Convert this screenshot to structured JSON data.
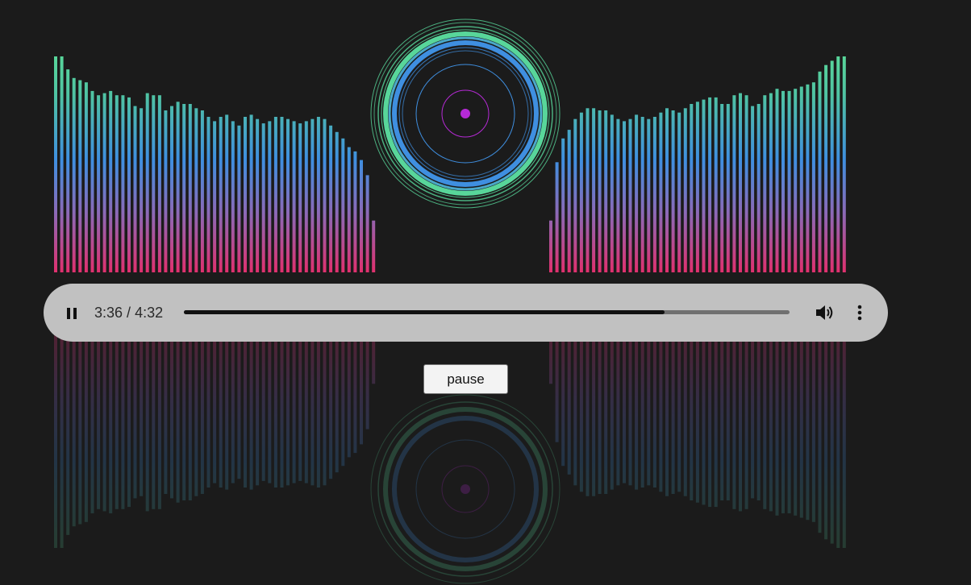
{
  "player": {
    "current_time": "3:36",
    "separator": " / ",
    "duration": "4:32",
    "progress": 0.7941
  },
  "pause_button": {
    "label": "pause"
  },
  "colors": {
    "background": "#1b1b1b",
    "bar_top": "#58d69a",
    "bar_mid": "#3f8fe0",
    "bar_bottom": "#e0306e",
    "disc_center": "#b62ad6",
    "player_bg": "#c1c1c1"
  },
  "icons": {
    "play_state": "pause-icon",
    "volume": "speaker-icon",
    "menu": "more-vertical-icon"
  },
  "spectrum": {
    "left_levels": [
      1.0,
      1.0,
      0.94,
      0.9,
      0.89,
      0.88,
      0.84,
      0.82,
      0.83,
      0.84,
      0.82,
      0.82,
      0.81,
      0.77,
      0.76,
      0.83,
      0.82,
      0.82,
      0.75,
      0.77,
      0.79,
      0.78,
      0.78,
      0.76,
      0.75,
      0.72,
      0.7,
      0.72,
      0.73,
      0.7,
      0.68,
      0.72,
      0.73,
      0.71,
      0.69,
      0.7,
      0.72,
      0.72,
      0.71,
      0.7,
      0.69,
      0.7,
      0.71,
      0.72,
      0.71,
      0.68,
      0.65,
      0.62,
      0.58,
      0.56,
      0.52,
      0.45,
      0.24
    ],
    "right_levels": [
      0.24,
      0.51,
      0.62,
      0.66,
      0.71,
      0.74,
      0.76,
      0.76,
      0.75,
      0.75,
      0.73,
      0.71,
      0.7,
      0.71,
      0.73,
      0.72,
      0.71,
      0.72,
      0.74,
      0.76,
      0.75,
      0.74,
      0.76,
      0.78,
      0.79,
      0.8,
      0.81,
      0.81,
      0.78,
      0.78,
      0.82,
      0.83,
      0.82,
      0.77,
      0.78,
      0.82,
      0.83,
      0.85,
      0.84,
      0.84,
      0.85,
      0.86,
      0.87,
      0.88,
      0.93,
      0.96,
      0.98,
      1.0,
      1.0
    ]
  }
}
